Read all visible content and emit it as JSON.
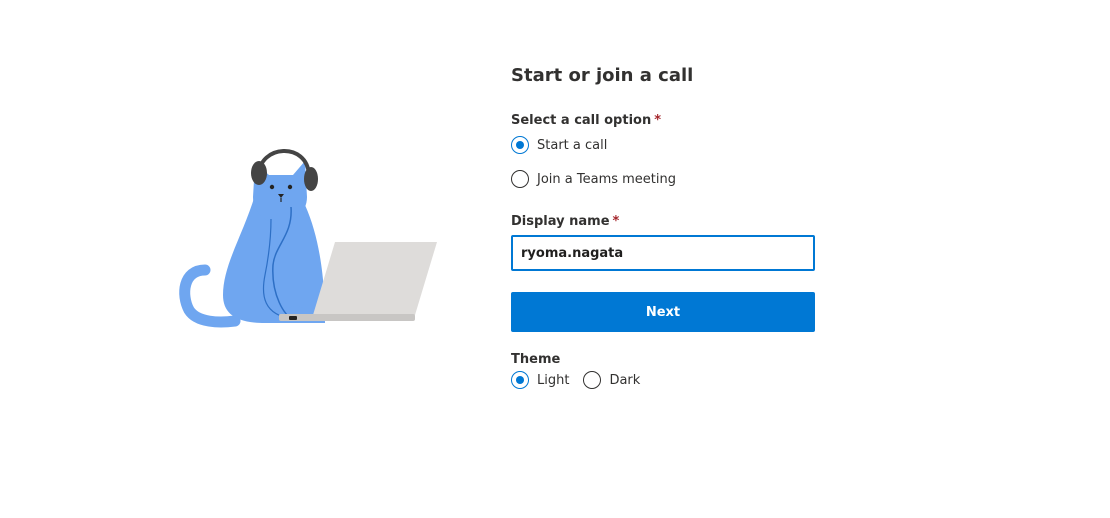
{
  "form": {
    "title": "Start or join a call",
    "call_option_label": "Select a call option",
    "required_mark": "*",
    "options": [
      {
        "label": "Start a call",
        "checked": true
      },
      {
        "label": "Join a Teams meeting",
        "checked": false
      }
    ],
    "display_name_label": "Display name",
    "display_name_value": "ryoma.nagata",
    "next_label": "Next",
    "theme_label": "Theme",
    "theme_options": [
      {
        "label": "Light",
        "checked": true
      },
      {
        "label": "Dark",
        "checked": false
      }
    ]
  },
  "colors": {
    "accent": "#0078d4",
    "cat": "#6fa6f0",
    "required": "#a4262c"
  }
}
